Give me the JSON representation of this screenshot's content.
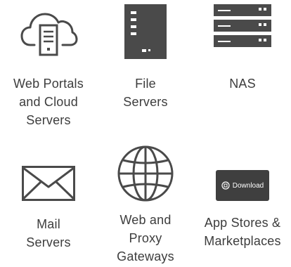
{
  "colors": {
    "icon": "#4a4a4a",
    "label": "#3d3d3d",
    "badge": "#3f3f3f"
  },
  "tiles": [
    {
      "icon": "cloud-server-icon",
      "lines": [
        "Web Portals",
        "and Cloud",
        "Servers"
      ]
    },
    {
      "icon": "file-server-icon",
      "lines": [
        "File",
        "Servers"
      ]
    },
    {
      "icon": "nas-icon",
      "lines": [
        "NAS"
      ]
    },
    {
      "icon": "mail-envelope-icon",
      "lines": [
        "Mail",
        "Servers"
      ]
    },
    {
      "icon": "globe-icon",
      "lines": [
        "Web and",
        "Proxy",
        "Gateways"
      ]
    },
    {
      "icon": "download-badge-icon",
      "badge_text": "Download",
      "lines": [
        "App Stores &",
        "Marketplaces"
      ]
    }
  ]
}
